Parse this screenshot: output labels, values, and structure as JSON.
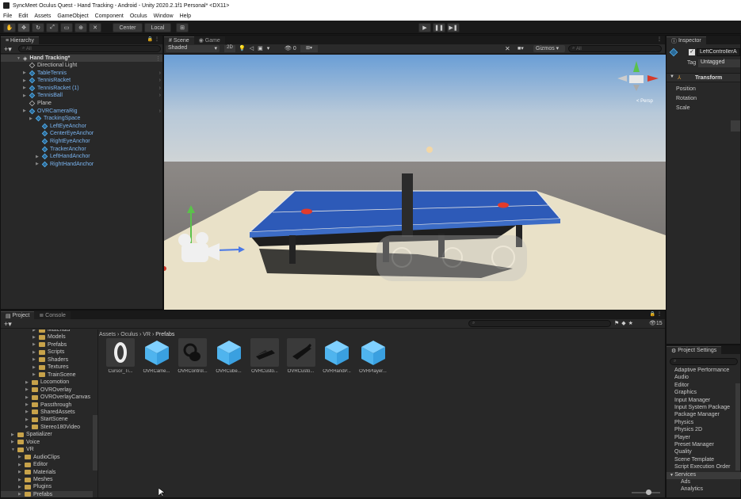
{
  "window": {
    "title": "SyncMeet Oculus Quest - Hand Tracking - Android - Unity 2020.2.1f1 Personal* <DX11>"
  },
  "menu": [
    "File",
    "Edit",
    "Assets",
    "GameObject",
    "Component",
    "Oculus",
    "Window",
    "Help"
  ],
  "toolbar": {
    "pivot_label": "Center",
    "space_label": "Local"
  },
  "hierarchy": {
    "tab": "Hierarchy",
    "search_placeholder": "All",
    "scene": "Hand Tracking*",
    "items": [
      {
        "label": "Directional Light",
        "depth": 1,
        "color": "white",
        "expander": false
      },
      {
        "label": "TableTennis",
        "depth": 1,
        "color": "blue",
        "expander": true
      },
      {
        "label": "TennisRacket",
        "depth": 1,
        "color": "blue",
        "expander": true
      },
      {
        "label": "TennisRacket (1)",
        "depth": 1,
        "color": "blue",
        "expander": true
      },
      {
        "label": "TennisBall",
        "depth": 1,
        "color": "blue",
        "expander": true
      },
      {
        "label": "Plane",
        "depth": 1,
        "color": "white",
        "expander": false
      },
      {
        "label": "OVRCameraRig",
        "depth": 1,
        "color": "blue",
        "expander": true
      },
      {
        "label": "TrackingSpace",
        "depth": 2,
        "color": "blue",
        "expander": true
      },
      {
        "label": "LeftEyeAnchor",
        "depth": 3,
        "color": "blue",
        "expander": false
      },
      {
        "label": "CenterEyeAnchor",
        "depth": 3,
        "color": "blue",
        "expander": false
      },
      {
        "label": "RightEyeAnchor",
        "depth": 3,
        "color": "blue",
        "expander": false
      },
      {
        "label": "TrackerAnchor",
        "depth": 3,
        "color": "blue",
        "expander": false
      },
      {
        "label": "LeftHandAnchor",
        "depth": 3,
        "color": "blue",
        "expander": true
      },
      {
        "label": "RightHandAnchor",
        "depth": 3,
        "color": "blue",
        "expander": true
      }
    ]
  },
  "scene_view": {
    "tabs": [
      "Scene",
      "Game"
    ],
    "shading": "Shaded",
    "mode_2d": "2D",
    "gizmos": "Gizmos",
    "search_placeholder": "All",
    "hidden_count": "0",
    "persp_label": "< Persp"
  },
  "inspector": {
    "tab": "Inspector",
    "object_name": "LeftControllerA",
    "tag_label": "Tag",
    "tag_value": "Untagged",
    "component": "Transform",
    "fields": [
      "Position",
      "Rotation",
      "Scale"
    ]
  },
  "project": {
    "tabs": [
      "Project",
      "Console"
    ],
    "breadcrumb": [
      "Assets",
      "Oculus",
      "VR",
      "Prefabs"
    ],
    "hidden_count": "15",
    "tree": [
      {
        "label": "Materials",
        "depth": 4
      },
      {
        "label": "Models",
        "depth": 4
      },
      {
        "label": "Prefabs",
        "depth": 4
      },
      {
        "label": "Scripts",
        "depth": 4
      },
      {
        "label": "Shaders",
        "depth": 4
      },
      {
        "label": "Textures",
        "depth": 4
      },
      {
        "label": "TrainScene",
        "depth": 4
      },
      {
        "label": "Locomotion",
        "depth": 3
      },
      {
        "label": "OVROverlay",
        "depth": 3
      },
      {
        "label": "OVROverlayCanvas",
        "depth": 3
      },
      {
        "label": "Passthrough",
        "depth": 3
      },
      {
        "label": "SharedAssets",
        "depth": 3
      },
      {
        "label": "StartScene",
        "depth": 3
      },
      {
        "label": "Stereo180Video",
        "depth": 3
      },
      {
        "label": "Spatializer",
        "depth": 1
      },
      {
        "label": "Voice",
        "depth": 1
      },
      {
        "label": "VR",
        "depth": 1
      },
      {
        "label": "AudioClips",
        "depth": 2
      },
      {
        "label": "Editor",
        "depth": 2
      },
      {
        "label": "Materials",
        "depth": 2
      },
      {
        "label": "Meshes",
        "depth": 2
      },
      {
        "label": "Plugins",
        "depth": 2
      },
      {
        "label": "Prefabs",
        "depth": 2
      }
    ],
    "assets": [
      {
        "label": "Cursor_Ti...",
        "kind": "cursor"
      },
      {
        "label": "OVRCame...",
        "kind": "cube"
      },
      {
        "label": "OVRControl...",
        "kind": "controller"
      },
      {
        "label": "OVRCube...",
        "kind": "cube"
      },
      {
        "label": "OVRCusto...",
        "kind": "hand"
      },
      {
        "label": "OVRCusto...",
        "kind": "hand2"
      },
      {
        "label": "OVRHandP...",
        "kind": "cube"
      },
      {
        "label": "OVRPlayer...",
        "kind": "cube"
      }
    ]
  },
  "project_settings": {
    "tab": "Project Settings",
    "items": [
      "Adaptive Performance",
      "Audio",
      "Editor",
      "Graphics",
      "Input Manager",
      "Input System Package",
      "Package Manager",
      "Physics",
      "Physics 2D",
      "Player",
      "Preset Manager",
      "Quality",
      "Scene Template",
      "Script Execution Order",
      "Services",
      "Ads",
      "Analytics"
    ],
    "selected": "Services"
  },
  "colors": {
    "accent": "#3a72b0",
    "hierarchy_blue": "#7ab4f0"
  }
}
